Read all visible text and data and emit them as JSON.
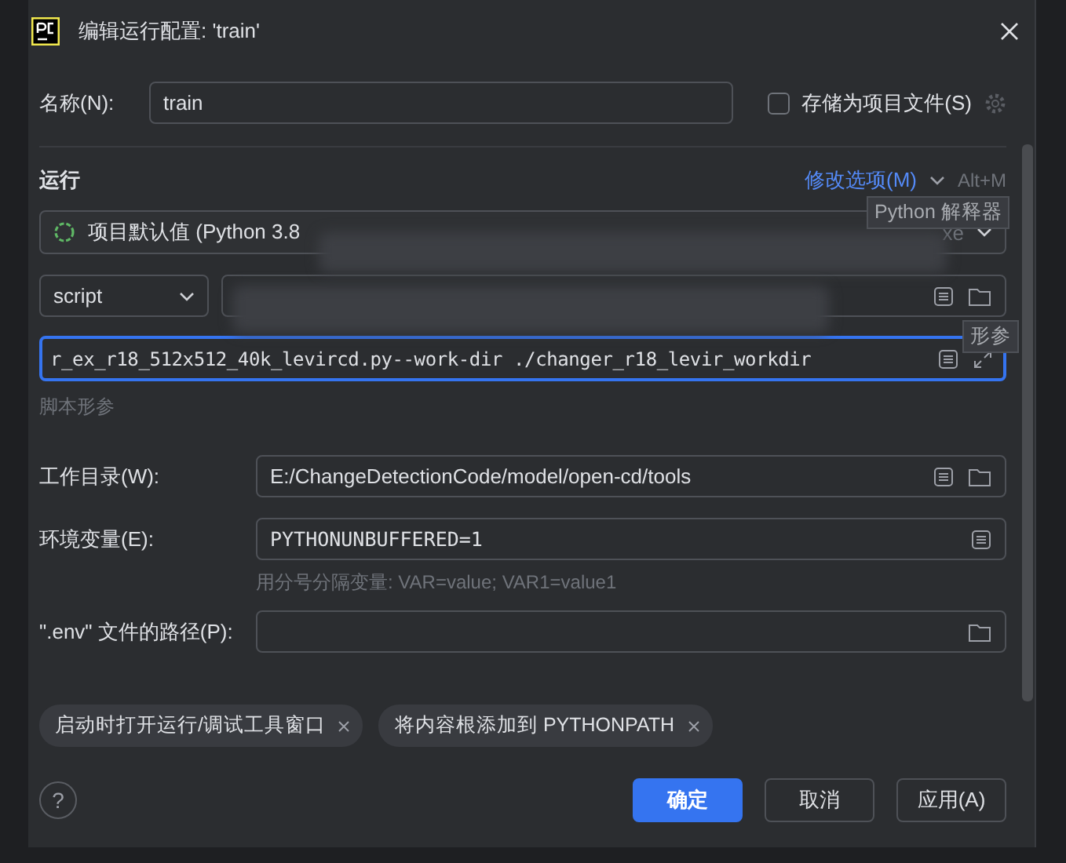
{
  "window": {
    "title": "编辑运行配置: 'train'"
  },
  "name_field": {
    "label": "名称(N):",
    "value": "train"
  },
  "store_as_project_file": {
    "label": "存储为项目文件(S)",
    "checked": false
  },
  "section": {
    "title": "运行",
    "modify_options": "修改选项(M)",
    "shortcut": "Alt+M"
  },
  "interpreter": {
    "value": "项目默认值 (Python 3.8",
    "suffix": "xe",
    "tooltip": "Python 解释器"
  },
  "script": {
    "mode": "script"
  },
  "parameters": {
    "value": "r_ex_r18_512x512_40k_levircd.py--work-dir ./changer_r18_levir_workdir",
    "tooltip": "形参",
    "hint": "脚本形参"
  },
  "fields": [
    {
      "label": "工作目录(W):",
      "value": "E:/ChangeDetectionCode/model/open-cd/tools",
      "kind": "path"
    },
    {
      "label": "环境变量(E):",
      "value": "PYTHONUNBUFFERED=1",
      "kind": "env",
      "hint": "用分号分隔变量: VAR=value; VAR1=value1"
    },
    {
      "label": "\".env\" 文件的路径(P):",
      "kind": "file"
    }
  ],
  "options": [
    {
      "label": "启动时打开运行/调试工具窗口"
    },
    {
      "label": "将内容根添加到 PYTHONPATH"
    }
  ],
  "help": "?",
  "buttons": [
    {
      "label": "确定",
      "kind": "primary"
    },
    {
      "label": "取消",
      "kind": "normal"
    },
    {
      "label": "应用(A)",
      "kind": "normal"
    }
  ]
}
